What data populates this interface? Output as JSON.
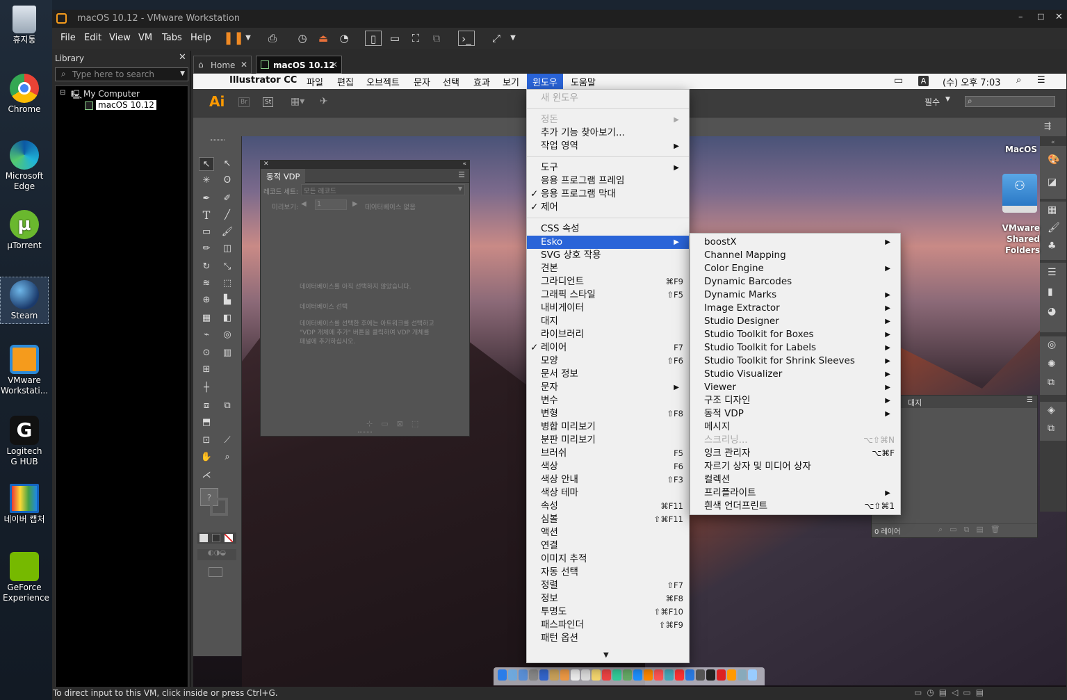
{
  "desktop": {
    "icons": [
      {
        "label": "휴지통",
        "icon": "recycle-bin-icon"
      },
      {
        "label": "Chrome",
        "icon": "chrome-icon"
      },
      {
        "label": "Microsoft Edge",
        "icon": "edge-icon"
      },
      {
        "label": "µTorrent",
        "icon": "utorrent-icon"
      },
      {
        "label": "Steam",
        "icon": "steam-icon"
      },
      {
        "label": "VMware Workstati...",
        "icon": "vmware-icon"
      },
      {
        "label": "Logitech G HUB",
        "icon": "logitech-icon"
      },
      {
        "label": "네이버 캡처",
        "icon": "naver-capture-icon"
      },
      {
        "label": "GeForce Experience",
        "icon": "geforce-icon"
      }
    ]
  },
  "vmware": {
    "title": "macOS 10.12 - VMware Workstation",
    "menu": [
      "File",
      "Edit",
      "View",
      "VM",
      "Tabs",
      "Help"
    ],
    "library": {
      "title": "Library",
      "search_placeholder": "Type here to search",
      "tree_root": "My Computer",
      "tree_child": "macOS 10.12"
    },
    "tabs": [
      {
        "label": "Home",
        "active": false
      },
      {
        "label": "macOS 10.12",
        "active": true
      }
    ],
    "status": "To direct input to this VM, click inside or press Ctrl+G."
  },
  "mac": {
    "app_name": "Illustrator CC",
    "menus": [
      "파일",
      "편집",
      "오브젝트",
      "문자",
      "선택",
      "효과",
      "보기",
      "윈도우",
      "도움말"
    ],
    "active_menu": "윈도우",
    "input_badge": "A",
    "clock": "(수) 오후 7:03",
    "workspace": "필수",
    "desktop_items": [
      "MacOS",
      "VMware Shared Folders"
    ]
  },
  "illustrator": {
    "logo": "Ai",
    "br": "Br",
    "st": "St",
    "vdp_panel": {
      "title": "동적 VDP",
      "record_set_label": "레코드 세트:",
      "record_set_value": "모든 레코드",
      "preview_label": "미리보기:",
      "preview_value": "1",
      "db_status": "데이터베이스 없음",
      "msg1": "데이터베이스를 아직 선택하지 않았습니다.",
      "msg2": "데이터베이스 선택",
      "msg3": "데이터베이스를 선택한 후에는 아트워크를 선택하고 \"VDP 개체에 추가\" 버튼을 클릭하여 VDP 개체를 패널에 추가하십시오."
    },
    "layers_panel": {
      "tab": "대지",
      "footer": "0 레이어"
    }
  },
  "window_menu": {
    "items": [
      {
        "label": "새 윈도우",
        "disabled": true
      },
      {
        "sep": true
      },
      {
        "label": "정돈",
        "disabled": true,
        "arrow": true
      },
      {
        "label": "추가 기능 찾아보기..."
      },
      {
        "label": "작업 영역",
        "arrow": true
      },
      {
        "sep": true
      },
      {
        "label": "도구",
        "arrow": true
      },
      {
        "label": "응용 프로그램 프레임"
      },
      {
        "label": "응용 프로그램 막대",
        "checked": true
      },
      {
        "label": "제어",
        "checked": true
      },
      {
        "sep": true
      },
      {
        "label": "CSS 속성"
      },
      {
        "label": "Esko",
        "arrow": true,
        "highlight": true
      },
      {
        "label": "SVG 상호 작용"
      },
      {
        "label": "견본"
      },
      {
        "label": "그라디언트",
        "shortcut": "⌘F9"
      },
      {
        "label": "그래픽 스타일",
        "shortcut": "⇧F5"
      },
      {
        "label": "내비게이터"
      },
      {
        "label": "대지"
      },
      {
        "label": "라이브러리"
      },
      {
        "label": "레이어",
        "checked": true,
        "shortcut": "F7"
      },
      {
        "label": "모양",
        "shortcut": "⇧F6"
      },
      {
        "label": "문서 정보"
      },
      {
        "label": "문자",
        "arrow": true
      },
      {
        "label": "변수"
      },
      {
        "label": "변형",
        "shortcut": "⇧F8"
      },
      {
        "label": "병합 미리보기"
      },
      {
        "label": "분판 미리보기"
      },
      {
        "label": "브러쉬",
        "shortcut": "F5"
      },
      {
        "label": "색상",
        "shortcut": "F6"
      },
      {
        "label": "색상 안내",
        "shortcut": "⇧F3"
      },
      {
        "label": "색상 테마"
      },
      {
        "label": "속성",
        "shortcut": "⌘F11"
      },
      {
        "label": "심볼",
        "shortcut": "⇧⌘F11"
      },
      {
        "label": "액션"
      },
      {
        "label": "연결"
      },
      {
        "label": "이미지 추적"
      },
      {
        "label": "자동 선택"
      },
      {
        "label": "정렬",
        "shortcut": "⇧F7"
      },
      {
        "label": "정보",
        "shortcut": "⌘F8"
      },
      {
        "label": "투명도",
        "shortcut": "⇧⌘F10"
      },
      {
        "label": "패스파인더",
        "shortcut": "⇧⌘F9"
      },
      {
        "label": "패턴 옵션"
      }
    ],
    "scroll_indicator": "▼"
  },
  "esko_menu": {
    "items": [
      {
        "label": "boostX",
        "arrow": true
      },
      {
        "label": "Channel Mapping"
      },
      {
        "label": "Color Engine",
        "arrow": true
      },
      {
        "label": "Dynamic Barcodes"
      },
      {
        "label": "Dynamic Marks",
        "arrow": true
      },
      {
        "label": "Image Extractor",
        "arrow": true
      },
      {
        "label": "Studio Designer",
        "arrow": true
      },
      {
        "label": "Studio Toolkit for Boxes",
        "arrow": true
      },
      {
        "label": "Studio Toolkit for Labels",
        "arrow": true
      },
      {
        "label": "Studio Toolkit for Shrink Sleeves",
        "arrow": true
      },
      {
        "label": "Studio Visualizer",
        "arrow": true
      },
      {
        "label": "Viewer",
        "arrow": true
      },
      {
        "label": "구조 디자인",
        "arrow": true
      },
      {
        "label": "동적 VDP",
        "arrow": true
      },
      {
        "label": "메시지"
      },
      {
        "label": "스크리닝...",
        "disabled": true,
        "shortcut": "⌥⇧⌘N"
      },
      {
        "label": "잉크 관리자",
        "shortcut": "⌥⌘F"
      },
      {
        "label": "자르기 상자 및 미디어 상자"
      },
      {
        "label": "컬렉션"
      },
      {
        "label": "프리플라이트",
        "arrow": true
      },
      {
        "label": "흰색 언더프린트",
        "shortcut": "⌥⇧⌘1"
      }
    ]
  },
  "colors": {
    "menu_highlight": "#2a64d8",
    "ai_orange": "#ff9a00",
    "vm_pause": "#f08a24"
  }
}
